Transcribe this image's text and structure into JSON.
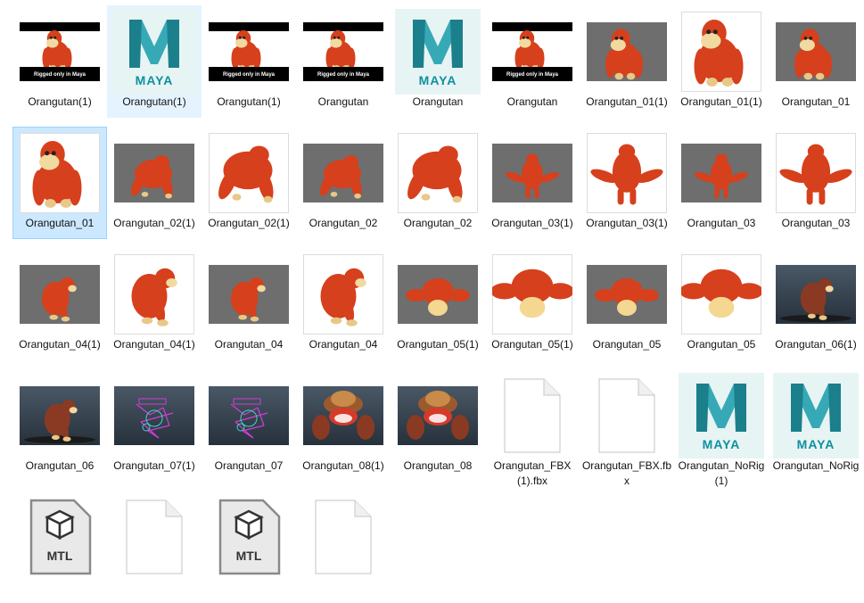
{
  "explorer": {
    "items": [
      {
        "label": "Orangutan(1)",
        "thumb": "banner"
      },
      {
        "label": "Orangutan(1)",
        "thumb": "maya-icon",
        "selected_style": "hovered"
      },
      {
        "label": "Orangutan(1)",
        "thumb": "banner"
      },
      {
        "label": "Orangutan",
        "thumb": "banner"
      },
      {
        "label": "Orangutan",
        "thumb": "maya-icon"
      },
      {
        "label": "Orangutan",
        "thumb": "banner"
      },
      {
        "label": "Orangutan_01(1)",
        "thumb": "gray-front"
      },
      {
        "label": "Orangutan_01(1)",
        "thumb": "white-front"
      },
      {
        "label": "Orangutan_01",
        "thumb": "gray-front"
      },
      {
        "label": "Orangutan_01",
        "thumb": "white-front",
        "selected_style": "selected"
      },
      {
        "label": "Orangutan_02(1)",
        "thumb": "gray-back"
      },
      {
        "label": "Orangutan_02(1)",
        "thumb": "white-back"
      },
      {
        "label": "Orangutan_02",
        "thumb": "gray-back"
      },
      {
        "label": "Orangutan_02",
        "thumb": "white-back"
      },
      {
        "label": "Orangutan_03(1)",
        "thumb": "gray-rear"
      },
      {
        "label": "Orangutan_03(1)",
        "thumb": "white-rear"
      },
      {
        "label": "Orangutan_03",
        "thumb": "gray-rear"
      },
      {
        "label": "Orangutan_03",
        "thumb": "white-rear"
      },
      {
        "label": "Orangutan_04(1)",
        "thumb": "gray-side"
      },
      {
        "label": "Orangutan_04(1)",
        "thumb": "white-side"
      },
      {
        "label": "Orangutan_04",
        "thumb": "gray-side"
      },
      {
        "label": "Orangutan_04",
        "thumb": "white-side"
      },
      {
        "label": "Orangutan_05(1)",
        "thumb": "gray-top"
      },
      {
        "label": "Orangutan_05(1)",
        "thumb": "white-top"
      },
      {
        "label": "Orangutan_05",
        "thumb": "gray-top"
      },
      {
        "label": "Orangutan_05",
        "thumb": "white-top"
      },
      {
        "label": "Orangutan_06(1)",
        "thumb": "dark-walk"
      },
      {
        "label": "Orangutan_06",
        "thumb": "dark-walk"
      },
      {
        "label": "Orangutan_07(1)",
        "thumb": "dark-rig"
      },
      {
        "label": "Orangutan_07",
        "thumb": "dark-rig"
      },
      {
        "label": "Orangutan_08(1)",
        "thumb": "dark-face"
      },
      {
        "label": "Orangutan_08",
        "thumb": "dark-face"
      },
      {
        "label": "Orangutan_FBX(1).fbx",
        "thumb": "file-icon"
      },
      {
        "label": "Orangutan_FBX.fbx",
        "thumb": "file-icon"
      },
      {
        "label": "Orangutan_NoRig(1)",
        "thumb": "maya-icon"
      },
      {
        "label": "Orangutan_NoRig",
        "thumb": "maya-icon"
      },
      {
        "label": "",
        "thumb": "mtl-icon"
      },
      {
        "label": "",
        "thumb": "file-icon"
      },
      {
        "label": "",
        "thumb": "mtl-icon"
      },
      {
        "label": "",
        "thumb": "file-icon"
      }
    ],
    "banner_text": "Rigged only in Maya",
    "maya_word": "MAYA",
    "mtl_word": "MTL"
  },
  "colors": {
    "selected_bg": "#cce8ff",
    "hover_bg": "#e5f3ff",
    "orangutan": "#d6401c",
    "maya_teal": "#0f8fa0"
  }
}
